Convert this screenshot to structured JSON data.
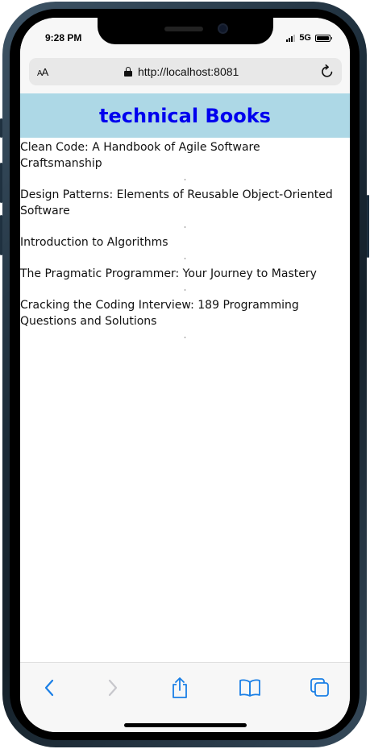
{
  "status": {
    "time": "9:28 PM",
    "network": "5G"
  },
  "browser": {
    "aa_label": "AA",
    "url": "http://localhost:8081"
  },
  "page": {
    "title": "technical Books",
    "books": [
      "Clean Code: A Handbook of Agile Software Craftsmanship",
      "Design Patterns: Elements of Reusable Object-Oriented Software",
      "Introduction to Algorithms",
      "The Pragmatic Programmer: Your Journey to Mastery",
      "Cracking the Coding Interview: 189 Programming Questions and Solutions"
    ]
  },
  "colors": {
    "header_bg": "#add8e6",
    "title": "#0000ee",
    "toolbar_accent": "#1a7fe6",
    "toolbar_disabled": "#c7c7cc"
  },
  "icons": {
    "back": "chevron-left-icon",
    "forward": "chevron-right-icon",
    "share": "share-icon",
    "bookmarks": "book-icon",
    "tabs": "tabs-icon",
    "reload": "reload-icon",
    "lock": "lock-icon"
  }
}
